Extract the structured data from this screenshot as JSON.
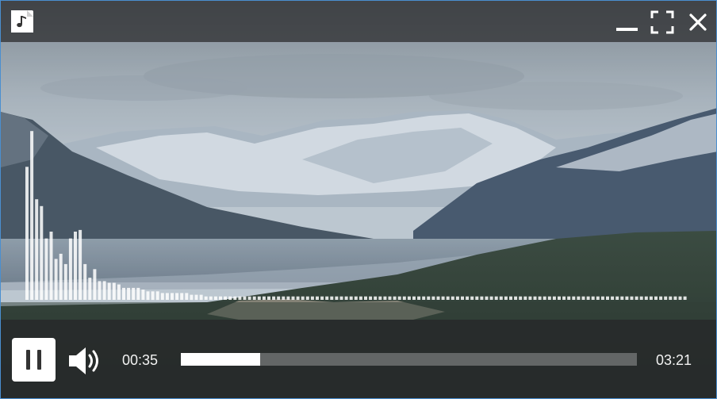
{
  "window": {
    "app_icon": "music-note-icon",
    "buttons": [
      {
        "name": "minimize-button",
        "icon": "minimize-icon"
      },
      {
        "name": "fullscreen-button",
        "icon": "fullscreen-icon"
      },
      {
        "name": "close-button",
        "icon": "close-icon"
      }
    ]
  },
  "background": {
    "description_icon": "mountain-landscape-image"
  },
  "visualizer": {
    "levels": [
      0.78,
      0.99,
      0.59,
      0.55,
      0.36,
      0.4,
      0.24,
      0.27,
      0.21,
      0.36,
      0.4,
      0.41,
      0.21,
      0.13,
      0.18,
      0.11,
      0.11,
      0.1,
      0.1,
      0.09,
      0.07,
      0.07,
      0.07,
      0.07,
      0.06,
      0.05,
      0.05,
      0.05,
      0.04,
      0.04,
      0.04,
      0.04,
      0.04,
      0.04,
      0.03,
      0.03,
      0.03,
      0.02,
      0.02,
      0.02,
      0.02,
      0.02,
      0.02,
      0.02,
      0.02,
      0.02,
      0.02,
      0.02,
      0.02,
      0.02,
      0.02,
      0.02,
      0.02,
      0.02,
      0.02,
      0.02,
      0.02,
      0.02,
      0.02,
      0.02,
      0.02,
      0.02,
      0.02,
      0.02,
      0.02,
      0.02,
      0.02,
      0.02,
      0.02,
      0.02,
      0.02,
      0.02,
      0.02,
      0.02,
      0.02,
      0.02,
      0.02,
      0.02,
      0.02,
      0.02,
      0.02,
      0.02,
      0.02,
      0.02,
      0.02,
      0.02,
      0.02,
      0.02,
      0.02,
      0.02,
      0.02,
      0.02,
      0.02,
      0.02,
      0.02,
      0.02,
      0.02,
      0.02,
      0.02,
      0.02,
      0.02,
      0.02,
      0.02,
      0.02,
      0.02,
      0.02,
      0.02,
      0.02,
      0.02,
      0.02,
      0.02,
      0.02,
      0.02,
      0.02,
      0.02,
      0.02,
      0.02,
      0.02,
      0.02,
      0.02,
      0.02,
      0.02,
      0.02,
      0.02,
      0.02,
      0.02,
      0.02,
      0.02,
      0.02,
      0.02,
      0.02,
      0.02,
      0.02,
      0.02,
      0.02,
      0.02,
      0.02
    ]
  },
  "controls": {
    "play_state_icon": "pause-icon",
    "volume_icon": "volume-icon",
    "elapsed": "00:35",
    "total": "03:21",
    "progress": 0.174
  },
  "colors": {
    "accent_border": "#4a8fd0",
    "bar_color": "#ffffff"
  }
}
